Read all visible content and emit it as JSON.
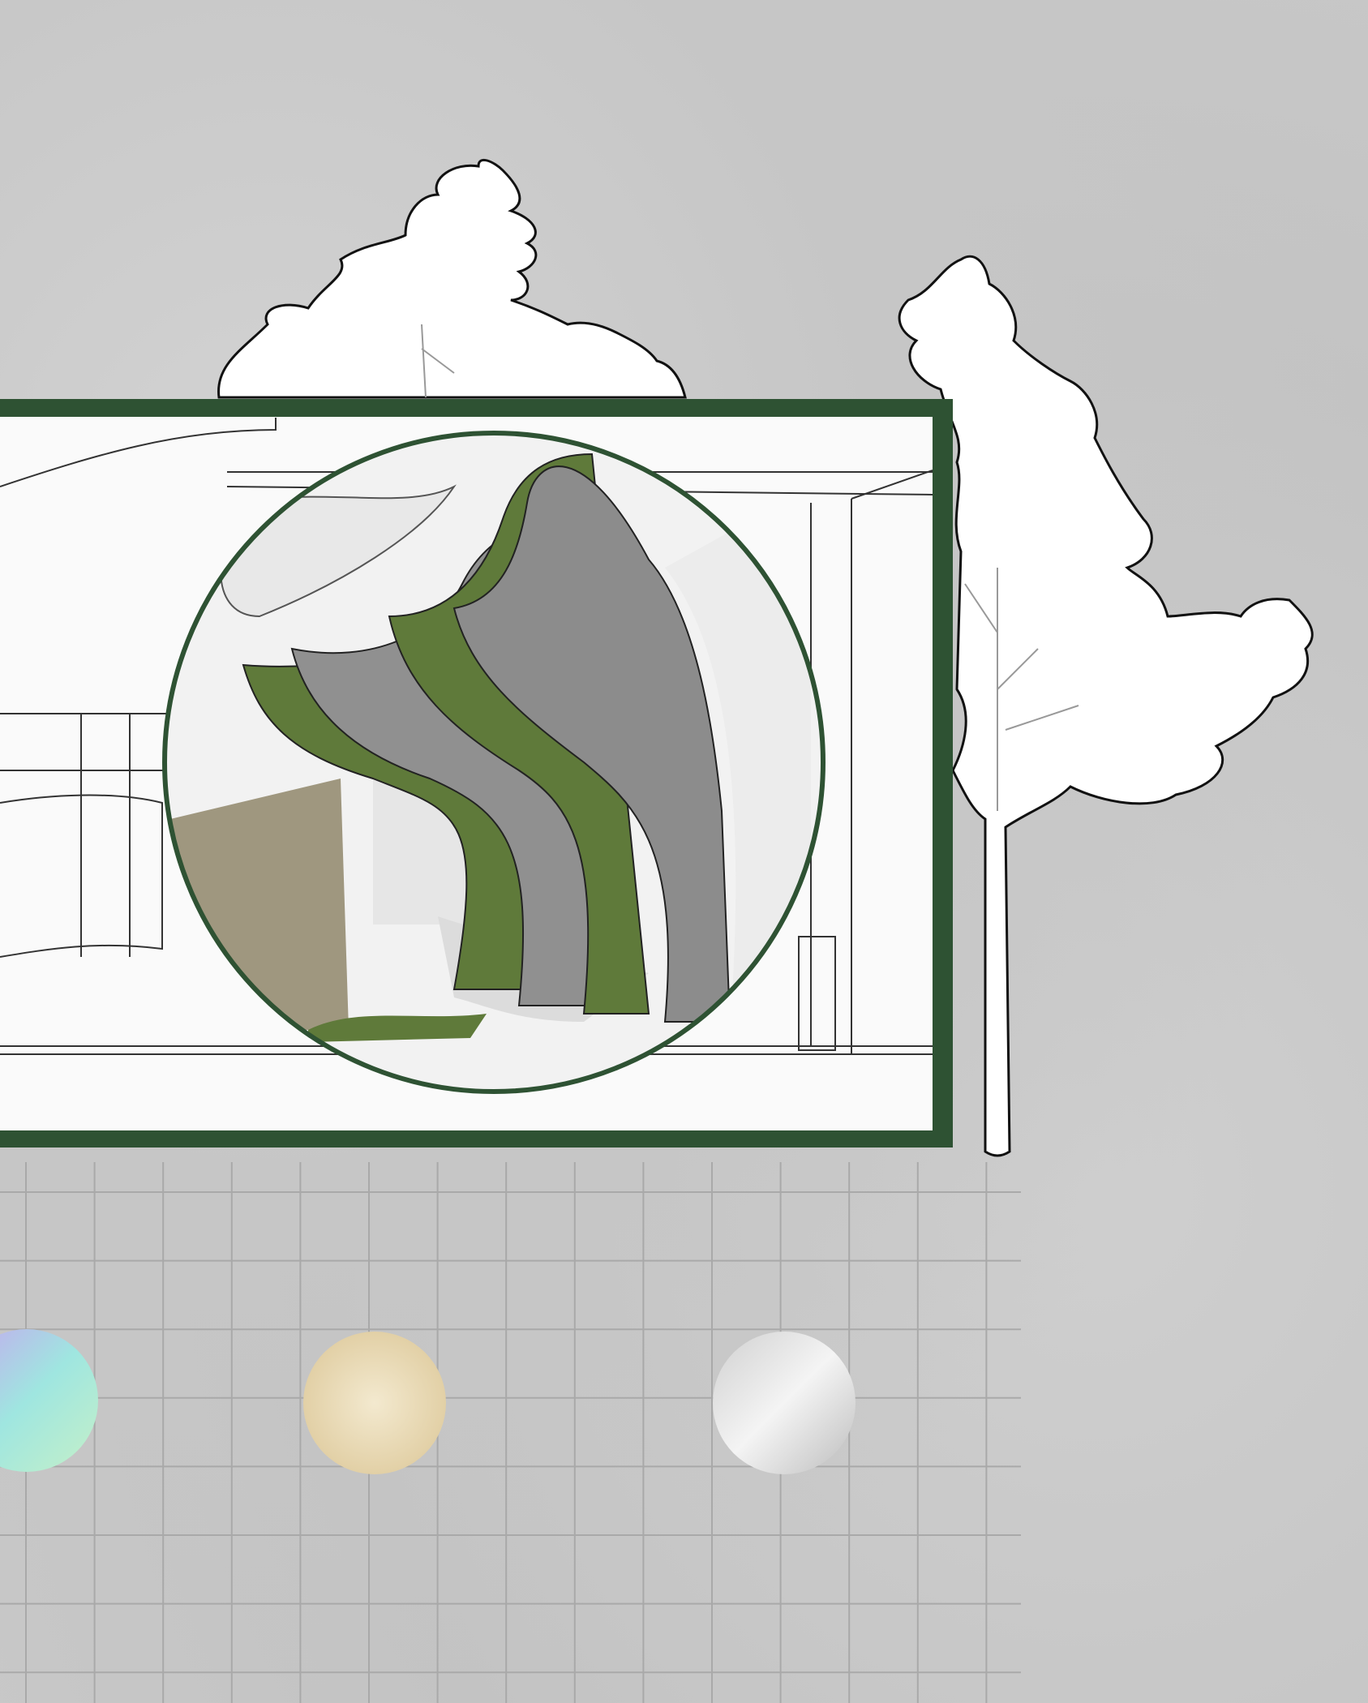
{
  "colors": {
    "background": "#c8c8c8",
    "frame": "#2e5233",
    "moss": "#5f7a3a",
    "felt": "#8f8f8f",
    "grid": "#a9a9a9"
  },
  "material_swatches": [
    {
      "name": "iridescent-film",
      "colors": [
        "#c7a6f0",
        "#9fe6e0",
        "#c5f0c8"
      ]
    },
    {
      "name": "light-wood-veneer",
      "colors": [
        "#efe3c6",
        "#d9c79c"
      ]
    },
    {
      "name": "brushed-aluminium",
      "colors": [
        "#d7d7d7",
        "#f4f4f4"
      ]
    }
  ],
  "elements": {
    "trees": [
      "tree-left",
      "tree-right"
    ],
    "rendering": "interior-perspective-with-circular-detail"
  }
}
